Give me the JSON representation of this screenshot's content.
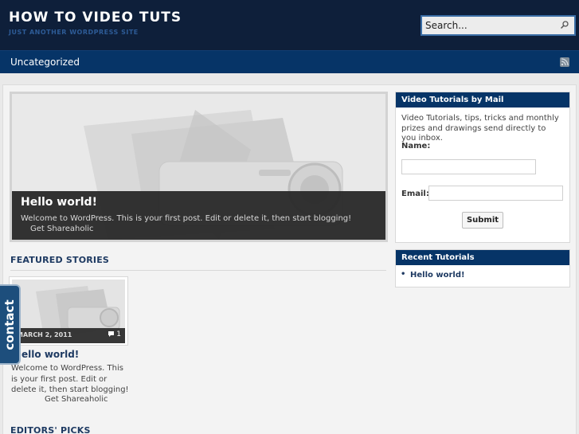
{
  "header": {
    "site_title": "HOW TO VIDEO TUTS",
    "tagline": "JUST ANOTHER WORDPRESS SITE",
    "search_placeholder": "Search..."
  },
  "nav": {
    "items": [
      {
        "label": "Uncategorized"
      }
    ]
  },
  "slider": {
    "title": "Hello world!",
    "excerpt": "Welcome to WordPress. This is your first post. Edit or delete it, then start blogging!",
    "share_text": "Get Shareaholic"
  },
  "featured": {
    "heading": "FEATURED STORIES",
    "post": {
      "date": "MARCH 2, 2011",
      "comments": "1",
      "title": "Hello world!",
      "excerpt": "Welcome to WordPress. This is your first post. Edit or delete it, then start blogging!",
      "share_text": "Get Shareaholic"
    }
  },
  "editors_picks": {
    "heading": "EDITORS' PICKS"
  },
  "contact_tab": {
    "label": "contact"
  },
  "sidebar": {
    "subscribe": {
      "title": "Video Tutorials by Mail",
      "text": "Video Tutorials, tips, tricks and monthly prizes and drawings send directly to you inbox.",
      "name_label": "Name:",
      "email_label": "Email:",
      "submit_label": "Submit"
    },
    "recent": {
      "title": "Recent Tutorials",
      "items": [
        {
          "label": "Hello world!"
        }
      ]
    }
  },
  "colors": {
    "header_bg": "#0e1f3a",
    "nav_bg": "#063467",
    "accent_blue": "#1e3a62",
    "contact_tab_bg": "#1d4e7c"
  },
  "icons": [
    "search-icon",
    "rss-icon",
    "comment-icon"
  ]
}
